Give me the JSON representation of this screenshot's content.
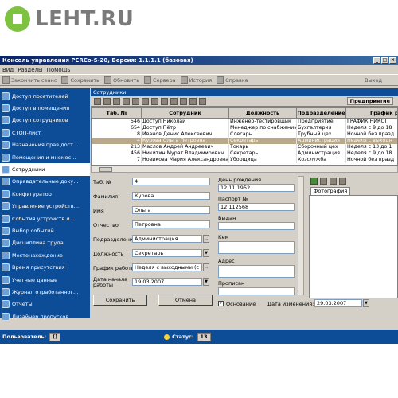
{
  "site": {
    "logo_text": "LEHT.RU",
    "logo_color": "#7ec242"
  },
  "window": {
    "title": "Консоль управления PERCo-S-20, Версия: 1.1.1.1 (базовая)"
  },
  "menu": [
    "Вид",
    "Разделы",
    "Помощь"
  ],
  "toolbar": {
    "items": [
      "Закончить сеанс",
      "Сохранить",
      "Обновить",
      "Сервера",
      "История",
      "Справка"
    ],
    "exit": "Выход"
  },
  "sidebar": {
    "items": [
      "Доступ посетителей",
      "Доступ в помещения",
      "Доступ сотрудников",
      "СТОП-лист",
      "Назначения прав дост…",
      "Помещения и мнемос…",
      "Сотрудники",
      "Оправдательные доку…",
      "Конфигуратор",
      "Управление устройств…",
      "События устройств и …",
      "Выбор событий",
      "Дисциплина труда",
      "Местонахождение",
      "Время присутствия",
      "Учетные данные",
      "Журнал отработанног…",
      "Отчеты",
      "Дизайнер пропусков"
    ],
    "active": 6
  },
  "panel": {
    "title": "Сотрудники",
    "predpriyatie": "Предприятие"
  },
  "grid": {
    "columns": [
      "Таб. №",
      "Сотрудник",
      "Должность",
      "Подразделение",
      "График ра"
    ],
    "rows": [
      [
        "546",
        "Доступ Николай",
        "Инженер-тестировщик",
        "Предприятие",
        "ГРАФИК НИКОГ"
      ],
      [
        "654",
        "Доступ Пётр",
        "Менеджер по снабжению",
        "Бухгалтерия",
        "Неделя с 9 до 18"
      ],
      [
        "8",
        "Иванов Денис Алексеевич",
        "Слесарь",
        "Трубный цех",
        "Ночной без празд"
      ],
      [
        "4",
        "Курова Ольга Петровна",
        "Секретарь",
        "Администрация",
        "Неделя с выходн"
      ],
      [
        "213",
        "Маслов Андрей Андреевич",
        "Токарь",
        "Сборочный цех",
        "Неделя с 13 до 1"
      ],
      [
        "456",
        "Никитин Мурат Владимирович",
        "Секретарь",
        "Администрация",
        "Неделя с 9 до 18"
      ],
      [
        "7",
        "Новикова Мария Александровна",
        "Уборщица",
        "Хозслужба",
        "Ночной без празд"
      ]
    ],
    "selected": 3
  },
  "form": {
    "tab_label": "Таб. №",
    "tab_value": "4",
    "surname_label": "Фамилия",
    "surname_value": "Курова",
    "name_label": "Имя",
    "name_value": "Ольга",
    "patronymic_label": "Отчество",
    "patronymic_value": "Петровна",
    "dept_label": "Подразделение",
    "dept_value": "Администрация",
    "position_label": "Должность",
    "position_value": "Секретарь",
    "schedule_label": "График работы",
    "schedule_value": "Неделя с выходными (с п",
    "start_label": "Дата начала работы",
    "start_value": "19.03.2007",
    "birth_label": "День рождения",
    "birth_value": "12.11.1952",
    "passport_label": "Паспорт №",
    "passport_value": "12.112568",
    "issued_label": "Выдан",
    "issued_by_label": "Кем",
    "address_label": "Адрес",
    "registered_label": "Прописан",
    "photo_tab": "Фотография",
    "save_button": "Сохранить",
    "cancel_button": "Отмена",
    "basis_label": "Основание",
    "change_date_label": "Дата изменения:",
    "change_date_value": "29.03.2007"
  },
  "status": {
    "user_label": "Пользователь:",
    "user_value": "()",
    "status_label": "Статус:",
    "status_value": "13"
  }
}
